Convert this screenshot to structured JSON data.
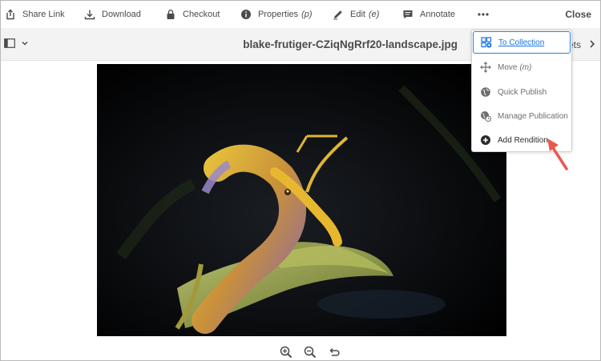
{
  "toolbar": {
    "share_link": "Share Link",
    "download": "Download",
    "checkout": "Checkout",
    "properties": "Properties",
    "properties_shortcut": "(p)",
    "edit": "Edit",
    "edit_shortcut": "(e)",
    "annotate": "Annotate",
    "more": "•••",
    "close": "Close"
  },
  "titlebar": {
    "file_name": "blake-frutiger-CZiqNgRrf20-landscape.jpg",
    "right_rail_label": "ets"
  },
  "menu": {
    "items": [
      {
        "label": "To Collection",
        "shortcut": ""
      },
      {
        "label": "Move",
        "shortcut": "(m)"
      },
      {
        "label": "Quick Publish",
        "shortcut": ""
      },
      {
        "label": "Manage Publication",
        "shortcut": ""
      },
      {
        "label": "Add Rendition",
        "shortcut": ""
      }
    ]
  },
  "icons": {
    "share": "share-icon",
    "download": "download-icon",
    "checkout": "lock-icon",
    "properties": "info-icon",
    "edit": "pencil-icon",
    "annotate": "comment-icon",
    "zoom_in": "zoom-in-icon",
    "zoom_out": "zoom-out-icon",
    "reset": "undo-icon"
  },
  "colors": {
    "accent": "#1473e6",
    "annotation_arrow": "#e8584f"
  }
}
